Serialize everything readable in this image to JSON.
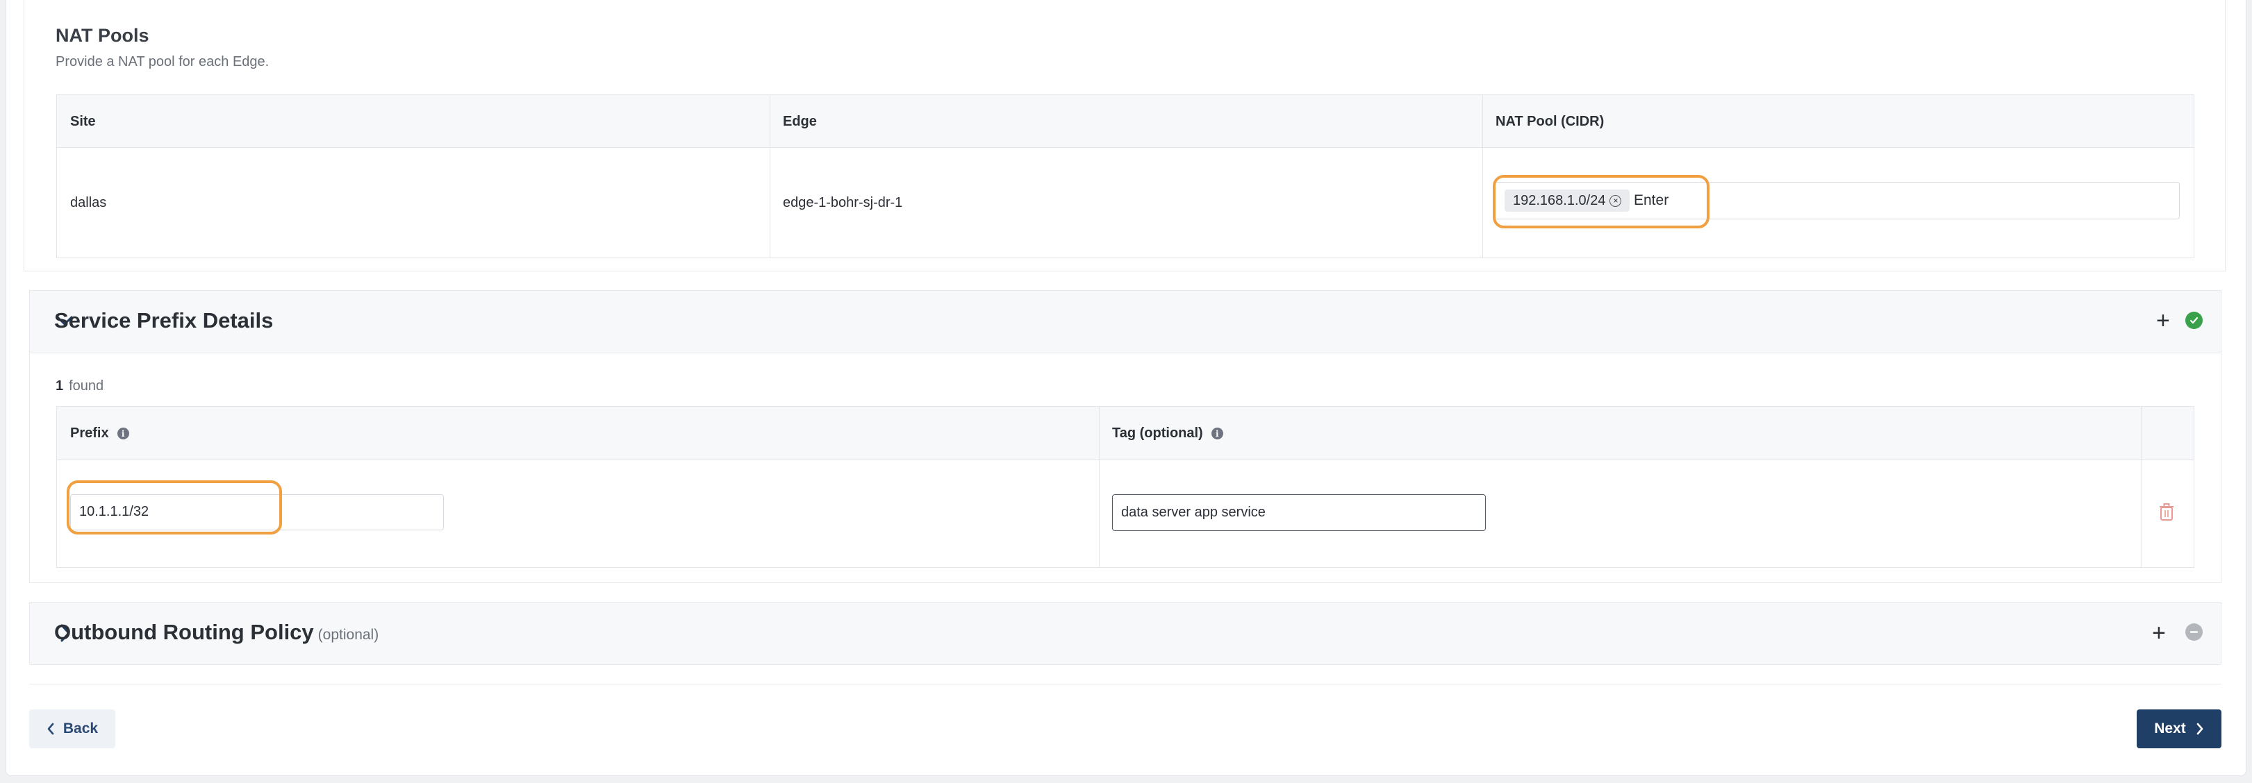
{
  "nat_pools": {
    "title": "NAT Pools",
    "subtitle": "Provide a NAT pool for each Edge.",
    "columns": [
      "Site",
      "Edge",
      "NAT Pool (CIDR)"
    ],
    "rows": [
      {
        "site": "dallas",
        "edge": "edge-1-bohr-sj-dr-1",
        "chips": [
          "192.168.1.0/24"
        ],
        "input_text": "Enter"
      }
    ]
  },
  "service_prefix": {
    "title": "Service Prefix Details",
    "count": "1",
    "count_label": "found",
    "columns": [
      "Prefix",
      "Tag (optional)"
    ],
    "rows": [
      {
        "prefix": "10.1.1.1/32",
        "tag": "data server app service"
      }
    ]
  },
  "outbound_routing": {
    "title": "Outbound Routing Policy",
    "optional_label": "(optional)"
  },
  "footer": {
    "back_label": "Back",
    "next_label": "Next"
  },
  "colors": {
    "primary": "#1f3f66",
    "highlight": "#f0a040",
    "success": "#3aa14b",
    "danger_icon": "#e99a94"
  }
}
